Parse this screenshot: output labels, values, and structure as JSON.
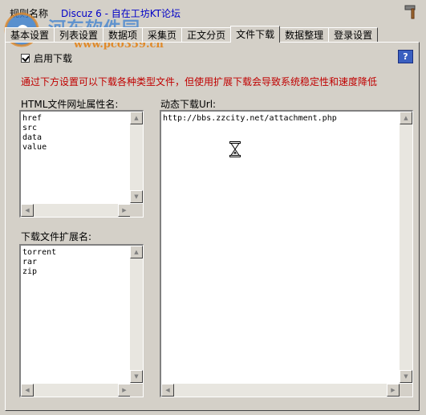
{
  "header": {
    "rule_label": "规则名称",
    "rule_name": "Discuz 6 - 自在工坊KT论坛"
  },
  "watermark": {
    "site_name": "河东软件园",
    "url": "www.pc0359.cn"
  },
  "tabs": [
    {
      "label": "基本设置",
      "active": false
    },
    {
      "label": "列表设置",
      "active": false
    },
    {
      "label": "数据项",
      "active": false
    },
    {
      "label": "采集页",
      "active": false
    },
    {
      "label": "正文分页",
      "active": false
    },
    {
      "label": "文件下载",
      "active": true
    },
    {
      "label": "数据整理",
      "active": false
    },
    {
      "label": "登录设置",
      "active": false
    }
  ],
  "enable_download": {
    "label": "启用下载",
    "checked": true
  },
  "help_icon": "?",
  "notice": "通过下方设置可以下载各种类型文件，但使用扩展下载会导致系统稳定性和速度降低",
  "html_attr": {
    "label": "HTML文件网址属性名:",
    "values": [
      "href",
      "src",
      "data",
      "value"
    ]
  },
  "dynamic_url": {
    "label": "动态下载Url:",
    "values": [
      "http://bbs.zzcity.net/attachment.php"
    ]
  },
  "file_ext": {
    "label": "下载文件扩展名:",
    "values": [
      "torrent",
      "rar",
      "zip"
    ]
  },
  "colors": {
    "background": "#d4d0c8",
    "notice": "#c00000",
    "rule_name": "#0000c8"
  }
}
